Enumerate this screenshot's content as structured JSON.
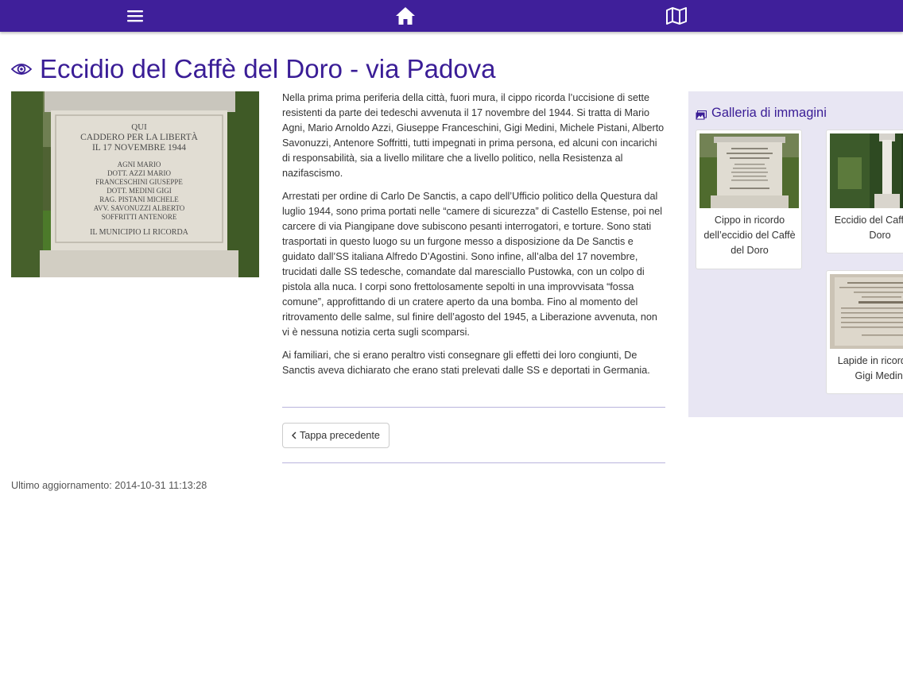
{
  "topbar": {
    "menu_icon": "hamburger-menu-icon",
    "home_icon": "home-icon",
    "map_icon": "map-icon",
    "color": "#3f1f9a"
  },
  "page": {
    "title_icon": "eye-icon",
    "title": "Eccidio del Caffè del Doro - via Padova",
    "title_color": "#3a1d96"
  },
  "photo": {
    "lines": [
      "QUI",
      "CADDERO PER LA LIBERTÀ",
      "IL 17 NOVEMBRE 1944",
      "AGNI MARIO",
      "DOTT. AZZI MARIO",
      "FRANCESCHINI GIUSEPPE",
      "DOTT. MEDINI GIGI",
      "RAG. PISTANI MICHELE",
      "AVV. SAVONUZZI ALBERTO",
      "SOFFRITTI ANTENORE",
      "IL MUNICIPIO LI RICORDA"
    ]
  },
  "article": {
    "paragraphs": [
      "Nella prima prima periferia della città, fuori mura, il cippo ricorda l’uccisione di sette resistenti da parte dei tedeschi avvenuta il 17 novembre del 1944. Si tratta di Mario Agni, Mario Arnoldo Azzi, Giuseppe Franceschini, Gigi Medini, Michele Pistani, Alberto Savonuzzi, Antenore Soffritti, tutti impegnati in prima persona, ed alcuni con incarichi di responsabilità, sia a livello militare che a livello politico, nella Resistenza al nazifascismo.",
      "Arrestati per ordine di Carlo De Sanctis, a capo dell’Ufficio politico della Questura dal luglio 1944, sono prima portati nelle “camere di sicurezza” di Castello Estense, poi nel carcere di via Piangipane dove subiscono pesanti interrogatori, e torture. Sono stati trasportati in questo luogo su un furgone messo a disposizione da De Sanctis e guidato dall’SS italiana Alfredo D’Agostini. Sono infine, all’alba del 17 novembre, trucidati dalle SS tedesche, comandate dal maresciallo Pustowka, con un colpo di pistola alla nuca. I corpi sono frettolosamente sepolti in una improvvisata “fossa comune”, approfittando di un cratere aperto da una bomba. Fino al momento del ritrovamento delle salme, sul finire dell’agosto del 1945, a Liberazione avvenuta, non vi è nessuna notizia certa sugli scomparsi.",
      "Ai familiari, che si erano peraltro visti consegnare gli effetti dei loro congiunti, De Sanctis aveva dichiarato che erano stati prelevati dalle SS e deportati in Germania."
    ]
  },
  "nav": {
    "prev_icon": "chevron-left-icon",
    "prev_label": "Tappa precedente"
  },
  "footer": {
    "updated": "Ultimo aggiornamento: 2014-10-31 11:13:28"
  },
  "gallery": {
    "icon": "pictures-icon",
    "title": "Galleria di immagini",
    "items": [
      {
        "caption": "Cippo in ricordo dell’eccidio del Caffè del Doro"
      },
      {
        "caption": "Eccidio del Caffè del Doro"
      },
      {
        "caption": "Lapide in ricordo di Gigi Medini"
      }
    ]
  }
}
